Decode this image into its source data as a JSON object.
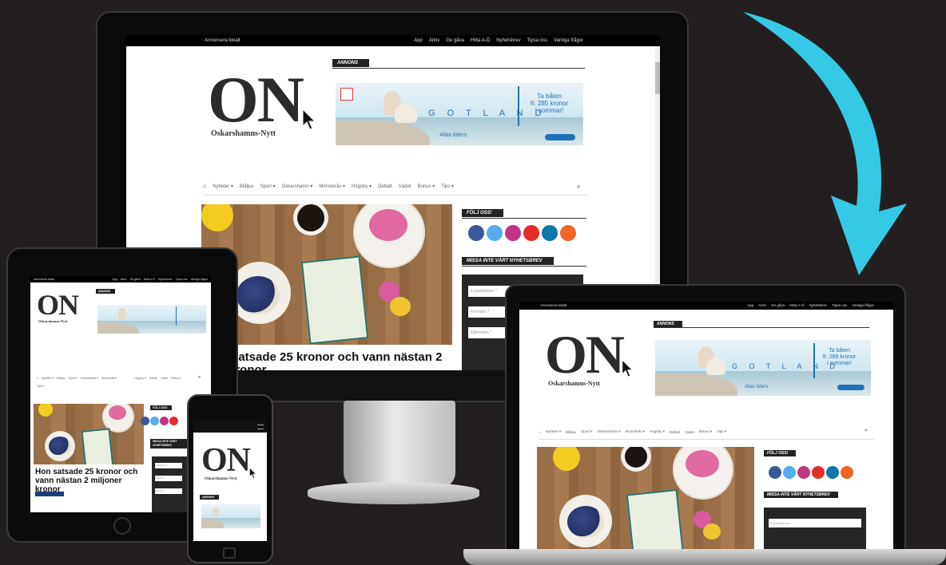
{
  "site": {
    "topbar_left": "Annonsera lokalt",
    "topbar_links": [
      "App",
      "Arkiv",
      "Ge gåva",
      "Hitta A-Ö",
      "Nyhetsbrev",
      "Tipsa oss",
      "Vanliga frågor"
    ],
    "logo_text": "ON",
    "logo_subtitle": "Oskarshamns-Nytt",
    "ad_label": "ANNONS",
    "ad": {
      "destination": "G O T L A N D",
      "offer_line1": "Ta båten",
      "offer_line2": "fr. 285 kronor",
      "offer_line3": "i sommar!",
      "tagline": "Allas tiders"
    },
    "nav_items": [
      "Nyheter ▾",
      "Blåljus",
      "Sport ▾",
      "Oskarshamn ▾",
      "Mönsterås ▾",
      "Högsby ▾",
      "Debatt",
      "Vädet",
      "Bonus ▾",
      "Tips ▾"
    ],
    "follow_heading": "FÖLJ OSS!",
    "newsletter_heading": "MISSA INTE VÅRT NYHETSBREV",
    "newsletter_fields": [
      "E-postadress *",
      "Förnamn *",
      "Efternamn *"
    ],
    "article_headline_desktop": "satsade 25 kronor och vann nästan 2",
    "article_headline_desktop_line2": "r kronor",
    "article_headline_tablet": "Hon satsade 25 kronor och vann nästan 2 miljoner kronor",
    "tablet_newsletter_heading": "MISSA INTE VÅRT NYHETSBREV"
  },
  "colors": {
    "background": "#231f20",
    "arrow": "#35c9e6",
    "dark": "#222222",
    "facebook": "#3b5998",
    "twitter": "#55acee",
    "instagram": "#c13584",
    "youtube": "#e52d27",
    "linkedin": "#0e76a8",
    "rss": "#f26522"
  },
  "icons": [
    "home-icon",
    "search-icon",
    "facebook-icon",
    "twitter-icon",
    "instagram-icon",
    "youtube-icon",
    "linkedin-icon",
    "rss-icon",
    "cursor-icon",
    "curved-arrow-icon"
  ]
}
